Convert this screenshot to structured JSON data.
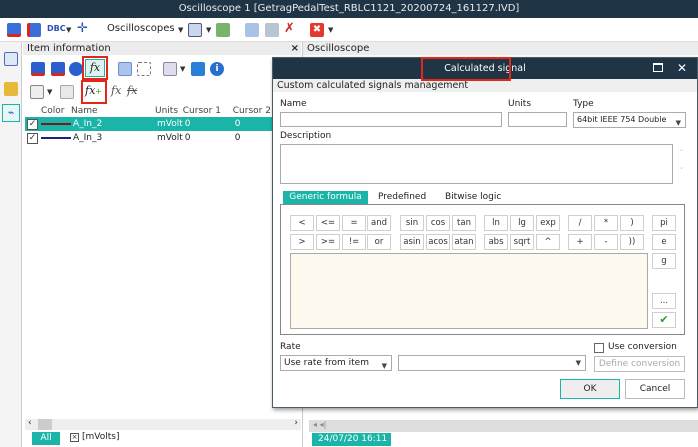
{
  "window": {
    "title": "Oscilloscope 1 [GetragPedalTest_RBLC1121_20200724_161127.IVD]"
  },
  "toolbar": {
    "dbc_label": "DBC",
    "oscilloscopes_label": "Oscilloscopes"
  },
  "item_panel": {
    "title": "Item information",
    "close": "×",
    "columns": [
      "Color",
      "Name",
      "Units",
      "Cursor 1",
      "Cursor 2"
    ],
    "rows": [
      {
        "checked": true,
        "color": "#7a1a1a",
        "name": "A_In_2",
        "units": "mVolt",
        "cursor1": "0",
        "cursor2": "0",
        "selected": true
      },
      {
        "checked": true,
        "color": "#1a237e",
        "name": "A_In_3",
        "units": "mVolt",
        "cursor1": "0",
        "cursor2": "0",
        "selected": false
      }
    ],
    "filter_tab": "All",
    "unit_filter": "[mVolts]",
    "unit_filter_mark": "×"
  },
  "osc_panel": {
    "title": "Oscilloscope",
    "timestamp": "24/07/20 16:11"
  },
  "dialog": {
    "title": "Calculated signal",
    "subtitle": "Custom calculated signals management",
    "name_label": "Name",
    "name_value": "",
    "units_label": "Units",
    "units_value": "",
    "type_label": "Type",
    "type_value": "64bit IEEE 754 Double",
    "description_label": "Description",
    "description_value": "",
    "tabs": [
      {
        "label": "Generic formula",
        "active": true
      },
      {
        "label": "Predefined",
        "active": false
      },
      {
        "label": "Bitwise logic",
        "active": false
      }
    ],
    "row1": [
      "<",
      "<=",
      "=",
      "and",
      "sin",
      "cos",
      "tan",
      "ln",
      "lg",
      "exp",
      "/",
      "*",
      ")",
      "pi"
    ],
    "row2": [
      ">",
      ">=",
      "!=",
      "or",
      "asin",
      "acos",
      "atan",
      "abs",
      "sqrt",
      "^",
      "+",
      "-",
      "))",
      "e"
    ],
    "side_g": "g",
    "side_more": "...",
    "check": "✔",
    "formula_value": "",
    "rate_label": "Rate",
    "rate_value": "Use rate from item",
    "rate2_value": "",
    "use_conversion": "Use conversion",
    "define_conversion": "Define conversion",
    "ok": "OK",
    "cancel": "Cancel"
  },
  "colors": {
    "accent": "#1ab5a8",
    "titlebar": "#1f3445",
    "highlight": "#e5261b",
    "formula_bg": "#fdf9ee"
  }
}
